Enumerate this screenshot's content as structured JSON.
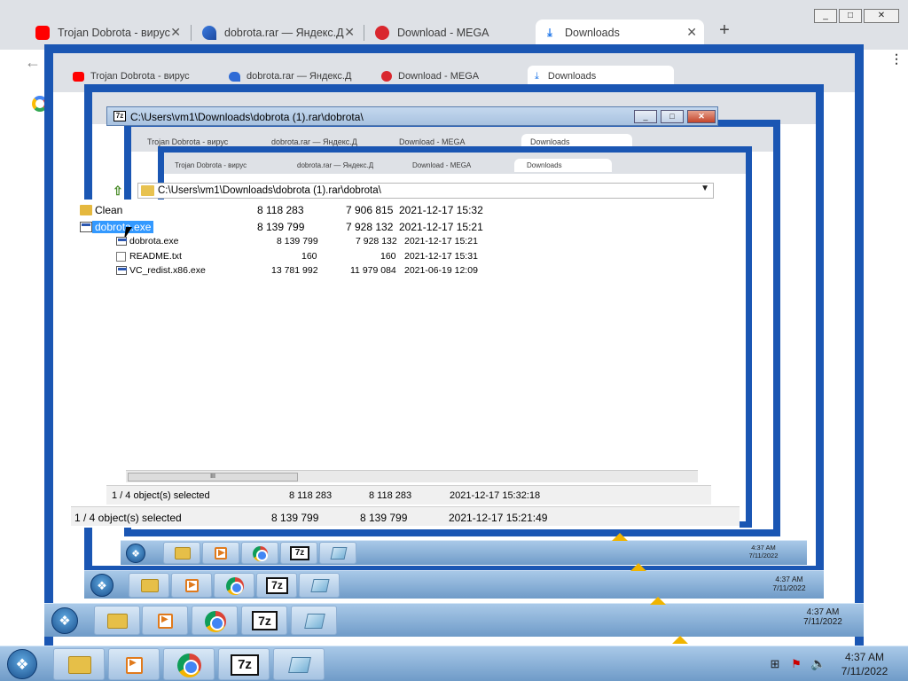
{
  "browser": {
    "tabs": [
      {
        "label": "Trojan Dobrota - вирус",
        "icon": "youtube-icon"
      },
      {
        "label": "dobrota.rar — Яндекс.Д",
        "icon": "yandex-disk-icon"
      },
      {
        "label": "Download - MEGA",
        "icon": "mega-icon"
      },
      {
        "label": "Downloads",
        "icon": "download-icon"
      }
    ],
    "new_tab": "+",
    "close_glyph": "✕",
    "menu_glyph": "⋮",
    "back_glyph": "←"
  },
  "sevenzip": {
    "title": "C:\\Users\\vm1\\Downloads\\dobrota (1).rar\\dobrota\\",
    "address": "C:\\Users\\vm1\\Downloads\\dobrota (1).rar\\dobrota\\",
    "app_icon": "7z",
    "outer_rows": [
      {
        "name": "Clean",
        "size": "8 118 283",
        "packed": "7 906 815",
        "modified": "2021-12-17 15:32",
        "type": "folder"
      },
      {
        "name": "dobrota.exe",
        "size": "8 139 799",
        "packed": "7 928 132",
        "modified": "2021-12-17 15:21",
        "type": "exe"
      }
    ],
    "inner_rows": [
      {
        "name": "dobrota.exe",
        "size": "8 139 799",
        "packed": "7 928 132",
        "modified": "2021-12-17 15:21",
        "type": "exe"
      },
      {
        "name": "README.txt",
        "size": "160",
        "packed": "160",
        "modified": "2021-12-17 15:31",
        "type": "txt"
      },
      {
        "name": "VC_redist.x86.exe",
        "size": "13 781 992",
        "packed": "11 979 084",
        "modified": "2021-06-19 12:09",
        "type": "exe"
      }
    ],
    "status_inner": {
      "selection": "1 / 4 object(s) selected",
      "size": "8 118 283",
      "packed": "8 118 283",
      "modified": "2021-12-17 15:32:18"
    },
    "status_outer": {
      "selection": "1 / 4 object(s) selected",
      "size": "8 139 799",
      "packed": "8 139 799",
      "modified": "2021-12-17 15:21:49"
    },
    "scroll_grip": "III"
  },
  "taskbar": {
    "time": "4:37 AM",
    "date": "7/11/2022",
    "seven_zip_label": "7z",
    "tray_icons": [
      "network-icon",
      "flag-error-icon",
      "volume-icon"
    ]
  },
  "colors": {
    "nested_border": "#1a56b3",
    "selection": "#3399ff",
    "chrome_strip": "#dee1e6"
  }
}
